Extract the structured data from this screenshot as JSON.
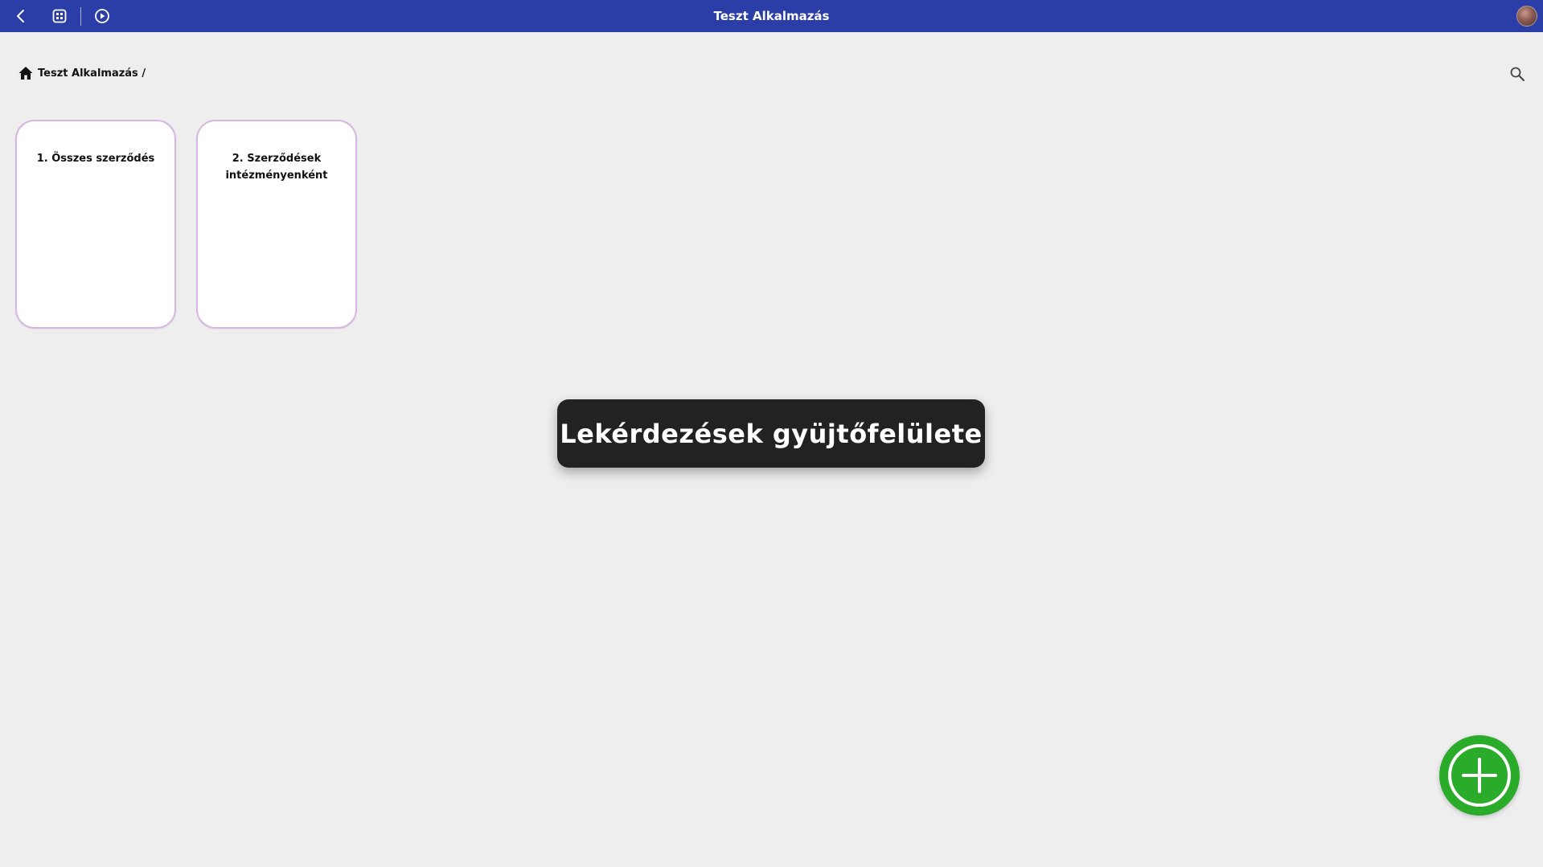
{
  "header": {
    "title": "Teszt Alkalmazás",
    "icons": {
      "back": "chevron-left-icon",
      "apps": "grid-icon",
      "play": "play-circle-icon"
    },
    "bar_color": "#2b3ea8"
  },
  "breadcrumb": {
    "home_icon": "home-icon",
    "path": "Teszt Alkalmazás /"
  },
  "search": {
    "icon": "search-icon"
  },
  "cards": [
    {
      "title": "1. Összes szerződés"
    },
    {
      "title": "2. Szerződések intézményenként"
    }
  ],
  "toast": {
    "text": "Lekérdezések gyüjtőfelülete"
  },
  "fab": {
    "icon": "plus-circle-icon",
    "color": "#2aab2a"
  }
}
